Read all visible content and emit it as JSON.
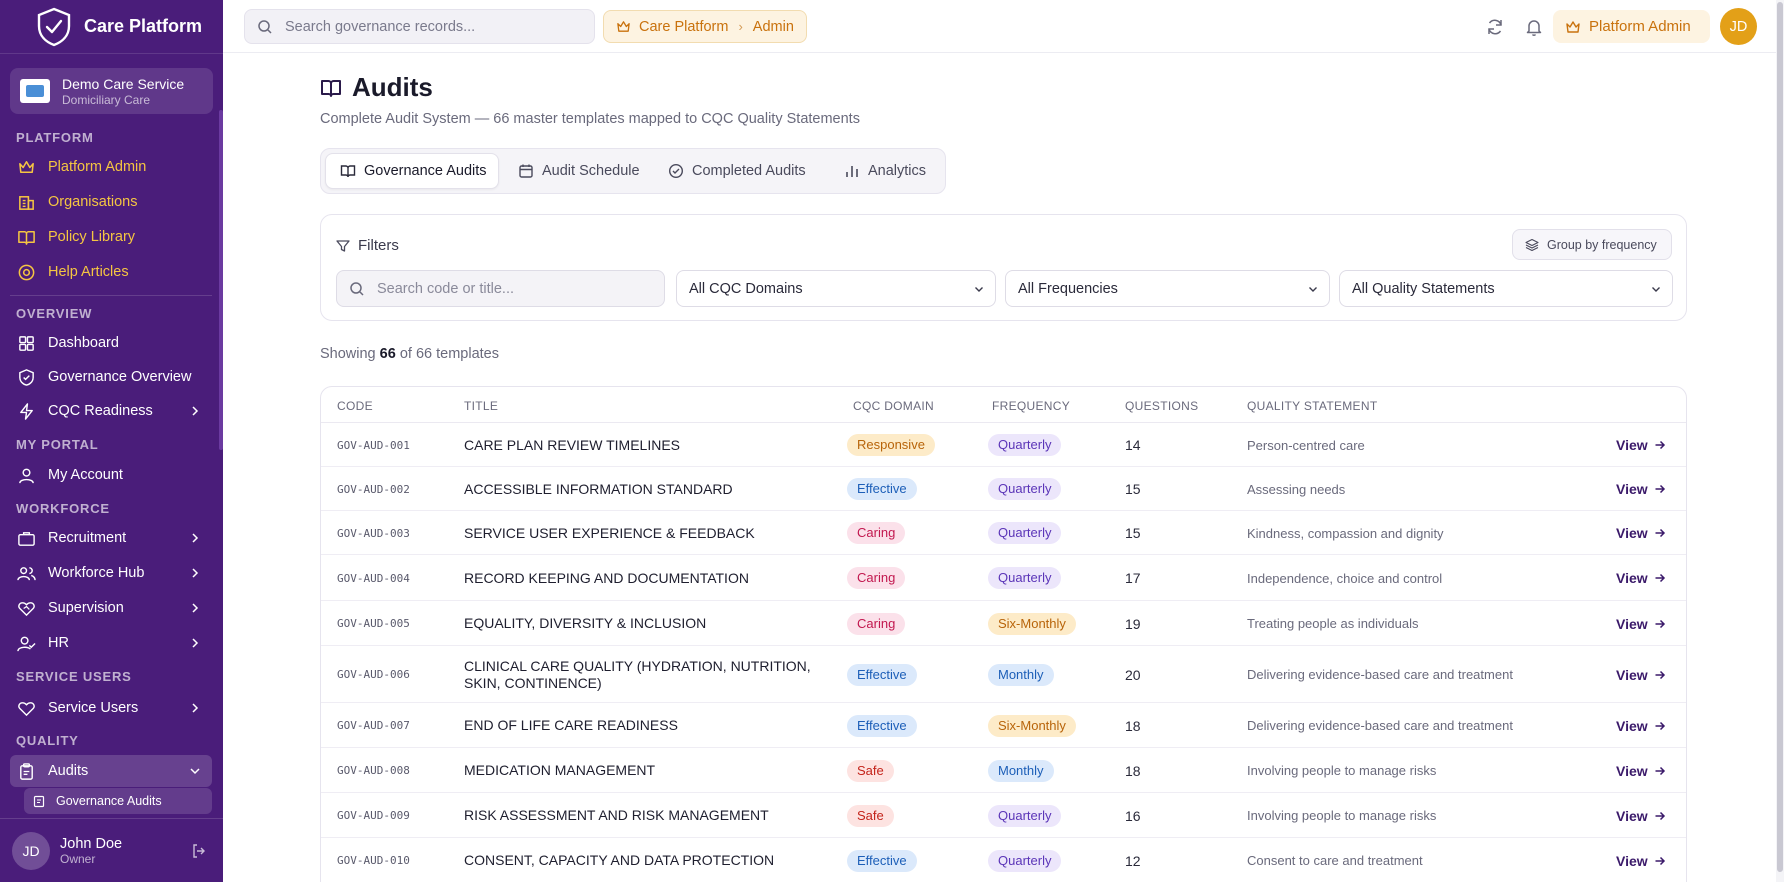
{
  "brand": {
    "name": "Care Platform"
  },
  "org": {
    "name": "Demo Care Service",
    "type": "Domiciliary Care"
  },
  "sidebar": {
    "sections": {
      "platform": "PLATFORM",
      "overview": "OVERVIEW",
      "my_portal": "MY PORTAL",
      "workforce": "WORKFORCE",
      "service_users": "SERVICE USERS",
      "quality": "QUALITY"
    },
    "items": {
      "platform_admin": "Platform Admin",
      "organisations": "Organisations",
      "policy_library": "Policy Library",
      "help_articles": "Help Articles",
      "dashboard": "Dashboard",
      "governance_overview": "Governance Overview",
      "cqc_readiness": "CQC Readiness",
      "my_account": "My Account",
      "recruitment": "Recruitment",
      "workforce_hub": "Workforce Hub",
      "supervision": "Supervision",
      "hr": "HR",
      "service_users": "Service Users",
      "audits": "Audits",
      "governance_audits": "Governance Audits"
    },
    "user": {
      "initials": "JD",
      "name": "John Doe",
      "role": "Owner"
    }
  },
  "topbar": {
    "search_placeholder": "Search governance records...",
    "breadcrumb": [
      "Care Platform",
      "Admin"
    ],
    "admin_label": "Platform Admin",
    "avatar": "JD"
  },
  "page": {
    "title": "Audits",
    "subtitle": "Complete Audit System — 66 master templates mapped to CQC Quality Statements",
    "tabs": [
      "Governance Audits",
      "Audit Schedule",
      "Completed Audits",
      "Analytics"
    ],
    "active_tab": 0
  },
  "filters": {
    "title": "Filters",
    "group_label": "Group by frequency",
    "search_placeholder": "Search code or title...",
    "domain": "All CQC Domains",
    "frequency": "All Frequencies",
    "statement": "All Quality Statements"
  },
  "showing": {
    "prefix": "Showing",
    "count": "66",
    "suffix": "of 66 templates"
  },
  "table": {
    "headers": [
      "CODE",
      "TITLE",
      "CQC DOMAIN",
      "FREQUENCY",
      "QUESTIONS",
      "QUALITY STATEMENT"
    ],
    "view_label": "View",
    "rows": [
      {
        "code": "GOV-AUD-001",
        "title": "CARE PLAN REVIEW TIMELINES",
        "domain": "Responsive",
        "frequency": "Quarterly",
        "questions": "14",
        "statement": "Person-centred care"
      },
      {
        "code": "GOV-AUD-002",
        "title": "ACCESSIBLE INFORMATION STANDARD",
        "domain": "Effective",
        "frequency": "Quarterly",
        "questions": "15",
        "statement": "Assessing needs"
      },
      {
        "code": "GOV-AUD-003",
        "title": "SERVICE USER EXPERIENCE & FEEDBACK",
        "domain": "Caring",
        "frequency": "Quarterly",
        "questions": "15",
        "statement": "Kindness, compassion and dignity"
      },
      {
        "code": "GOV-AUD-004",
        "title": "RECORD KEEPING AND DOCUMENTATION",
        "domain": "Caring",
        "frequency": "Quarterly",
        "questions": "17",
        "statement": "Independence, choice and control"
      },
      {
        "code": "GOV-AUD-005",
        "title": "EQUALITY, DIVERSITY & INCLUSION",
        "domain": "Caring",
        "frequency": "Six-Monthly",
        "questions": "19",
        "statement": "Treating people as individuals"
      },
      {
        "code": "GOV-AUD-006",
        "title": "CLINICAL CARE QUALITY (HYDRATION, NUTRITION, SKIN, CONTINENCE)",
        "domain": "Effective",
        "frequency": "Monthly",
        "questions": "20",
        "statement": "Delivering evidence-based care and treatment"
      },
      {
        "code": "GOV-AUD-007",
        "title": "END OF LIFE CARE READINESS",
        "domain": "Effective",
        "frequency": "Six-Monthly",
        "questions": "18",
        "statement": "Delivering evidence-based care and treatment"
      },
      {
        "code": "GOV-AUD-008",
        "title": "MEDICATION MANAGEMENT",
        "domain": "Safe",
        "frequency": "Monthly",
        "questions": "18",
        "statement": "Involving people to manage risks"
      },
      {
        "code": "GOV-AUD-009",
        "title": "RISK ASSESSMENT AND RISK MANAGEMENT",
        "domain": "Safe",
        "frequency": "Quarterly",
        "questions": "16",
        "statement": "Involving people to manage risks"
      },
      {
        "code": "GOV-AUD-010",
        "title": "CONSENT, CAPACITY AND DATA PROTECTION",
        "domain": "Effective",
        "frequency": "Quarterly",
        "questions": "12",
        "statement": "Consent to care and treatment"
      }
    ]
  },
  "colors": {
    "sidebar_bg": "#4a1d7a",
    "accent_gold": "#f5c542",
    "admin_orange": "#c9720d",
    "domain": {
      "Responsive": {
        "bg": "#fdebc8",
        "fg": "#b8640a"
      },
      "Effective": {
        "bg": "#dbe9fb",
        "fg": "#1d5fb8"
      },
      "Caring": {
        "bg": "#fbe1ea",
        "fg": "#c2184f"
      },
      "Safe": {
        "bg": "#fde3e1",
        "fg": "#c4241b"
      }
    },
    "frequency": {
      "Quarterly": {
        "bg": "#ece6fb",
        "fg": "#5b35b8"
      },
      "Six-Monthly": {
        "bg": "#fdebc8",
        "fg": "#b8640a"
      },
      "Monthly": {
        "bg": "#dbe9fb",
        "fg": "#1d5fb8"
      }
    }
  }
}
